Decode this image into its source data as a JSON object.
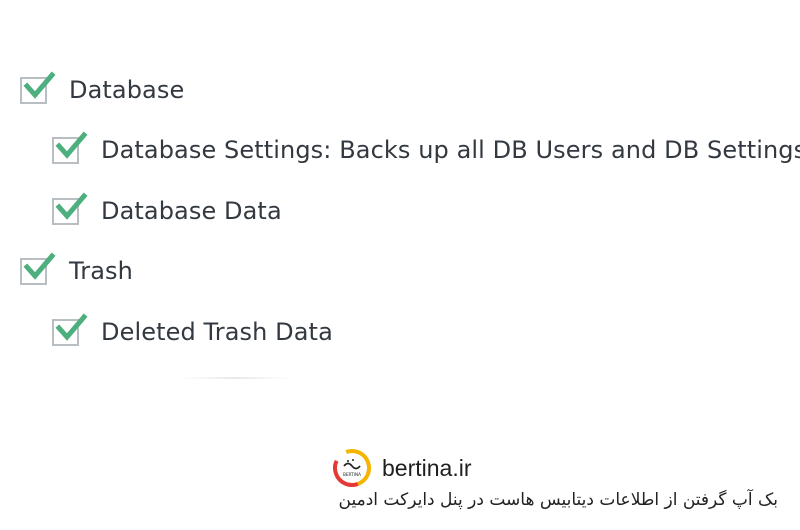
{
  "options": [
    {
      "label": "Database",
      "checked": true
    },
    {
      "label": "Database Settings: Backs up all DB Users and DB Settings",
      "checked": true
    },
    {
      "label": "Database Data",
      "checked": true
    },
    {
      "label": "Trash",
      "checked": true
    },
    {
      "label": "Deleted Trash Data",
      "checked": true
    }
  ],
  "check_color": "#4caf7d",
  "brand": {
    "name": "bertina.ir",
    "logo_text": "BERTINA",
    "logo_colors": [
      "#f4b400",
      "#e53935"
    ]
  },
  "caption": "بک آپ گرفتن از اطلاعات دیتابیس هاست در پنل دایرکت ادمین"
}
